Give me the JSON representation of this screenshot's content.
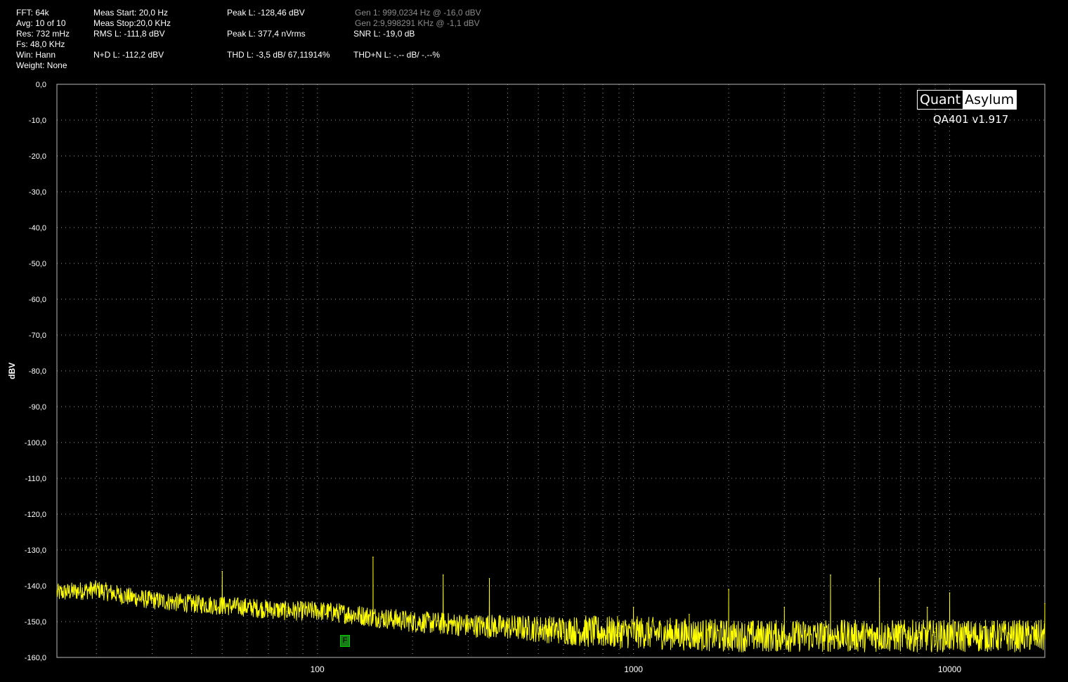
{
  "stats": {
    "fft": "FFT: 64k",
    "avg": "Avg: 10 of 10",
    "res": "Res: 732 mHz",
    "fs": "Fs: 48,0 KHz",
    "win": "Win: Hann",
    "weight": "Weight: None",
    "meas_start": "Meas Start: 20,0 Hz",
    "meas_stop": "Meas Stop:20,0 KHz",
    "rms_l": "RMS L: -111,8 dBV",
    "nd_l": "N+D L: -112,2 dBV",
    "peak_l_dbv": "Peak L: -128,46 dBV",
    "peak_l_vrms": "Peak L: 377,4 nVrms",
    "thd_l": "THD L: -3,5 dB/ 67,11914%",
    "gen1": "Gen 1: 999,0234 Hz @ -16,0  dBV",
    "gen2": "Gen 2:9,998291 KHz @ -1,1  dBV",
    "snr_l": "SNR L: -19,0 dB",
    "thdn_l": "THD+N L: -.-- dB/ -.--%"
  },
  "logo": {
    "quant": "Quant",
    "asylum": "Asylum"
  },
  "version": "QA401 v1.917",
  "marker": "F",
  "colors": {
    "background": "#000000",
    "trace": "#ffff00",
    "grid": "#9a9a9a",
    "marker": "#1a7a1a"
  },
  "chart_data": {
    "type": "line",
    "ylabel": "dBV",
    "xlabel": "",
    "x_scale": "log",
    "xlim": [
      15,
      20000
    ],
    "ylim": [
      -160,
      0
    ],
    "grid": true,
    "y_ticks": [
      "0,0",
      "-10,0",
      "-20,0",
      "-30,0",
      "-40,0",
      "-50,0",
      "-60,0",
      "-70,0",
      "-80,0",
      "-90,0",
      "-100,0",
      "-110,0",
      "-120,0",
      "-130,0",
      "-140,0",
      "-150,0",
      "-160,0"
    ],
    "x_ticks": [
      {
        "value": 100,
        "label": "100"
      },
      {
        "value": 1000,
        "label": "1000"
      },
      {
        "value": 10000,
        "label": "10000"
      }
    ],
    "series": [
      {
        "color": "#ffff00",
        "noise_floor": [
          [
            15,
            -142
          ],
          [
            20,
            -141
          ],
          [
            25,
            -143
          ],
          [
            30,
            -144
          ],
          [
            40,
            -145
          ],
          [
            60,
            -146
          ],
          [
            80,
            -147
          ],
          [
            100,
            -147
          ],
          [
            130,
            -148
          ],
          [
            200,
            -150
          ],
          [
            300,
            -151
          ],
          [
            500,
            -152
          ],
          [
            800,
            -153
          ],
          [
            1000,
            -153
          ],
          [
            2000,
            -154
          ],
          [
            5000,
            -154
          ],
          [
            10000,
            -154
          ],
          [
            20000,
            -154
          ]
        ],
        "spurs": [
          [
            50,
            -136
          ],
          [
            150,
            -132
          ],
          [
            250,
            -137
          ],
          [
            350,
            -138
          ],
          [
            1000,
            -146
          ],
          [
            1500,
            -148
          ],
          [
            2000,
            -141
          ],
          [
            3000,
            -146
          ],
          [
            4200,
            -137
          ],
          [
            6000,
            -138
          ],
          [
            8500,
            -146
          ],
          [
            10000,
            -142
          ],
          [
            20000,
            -145
          ]
        ]
      }
    ]
  }
}
